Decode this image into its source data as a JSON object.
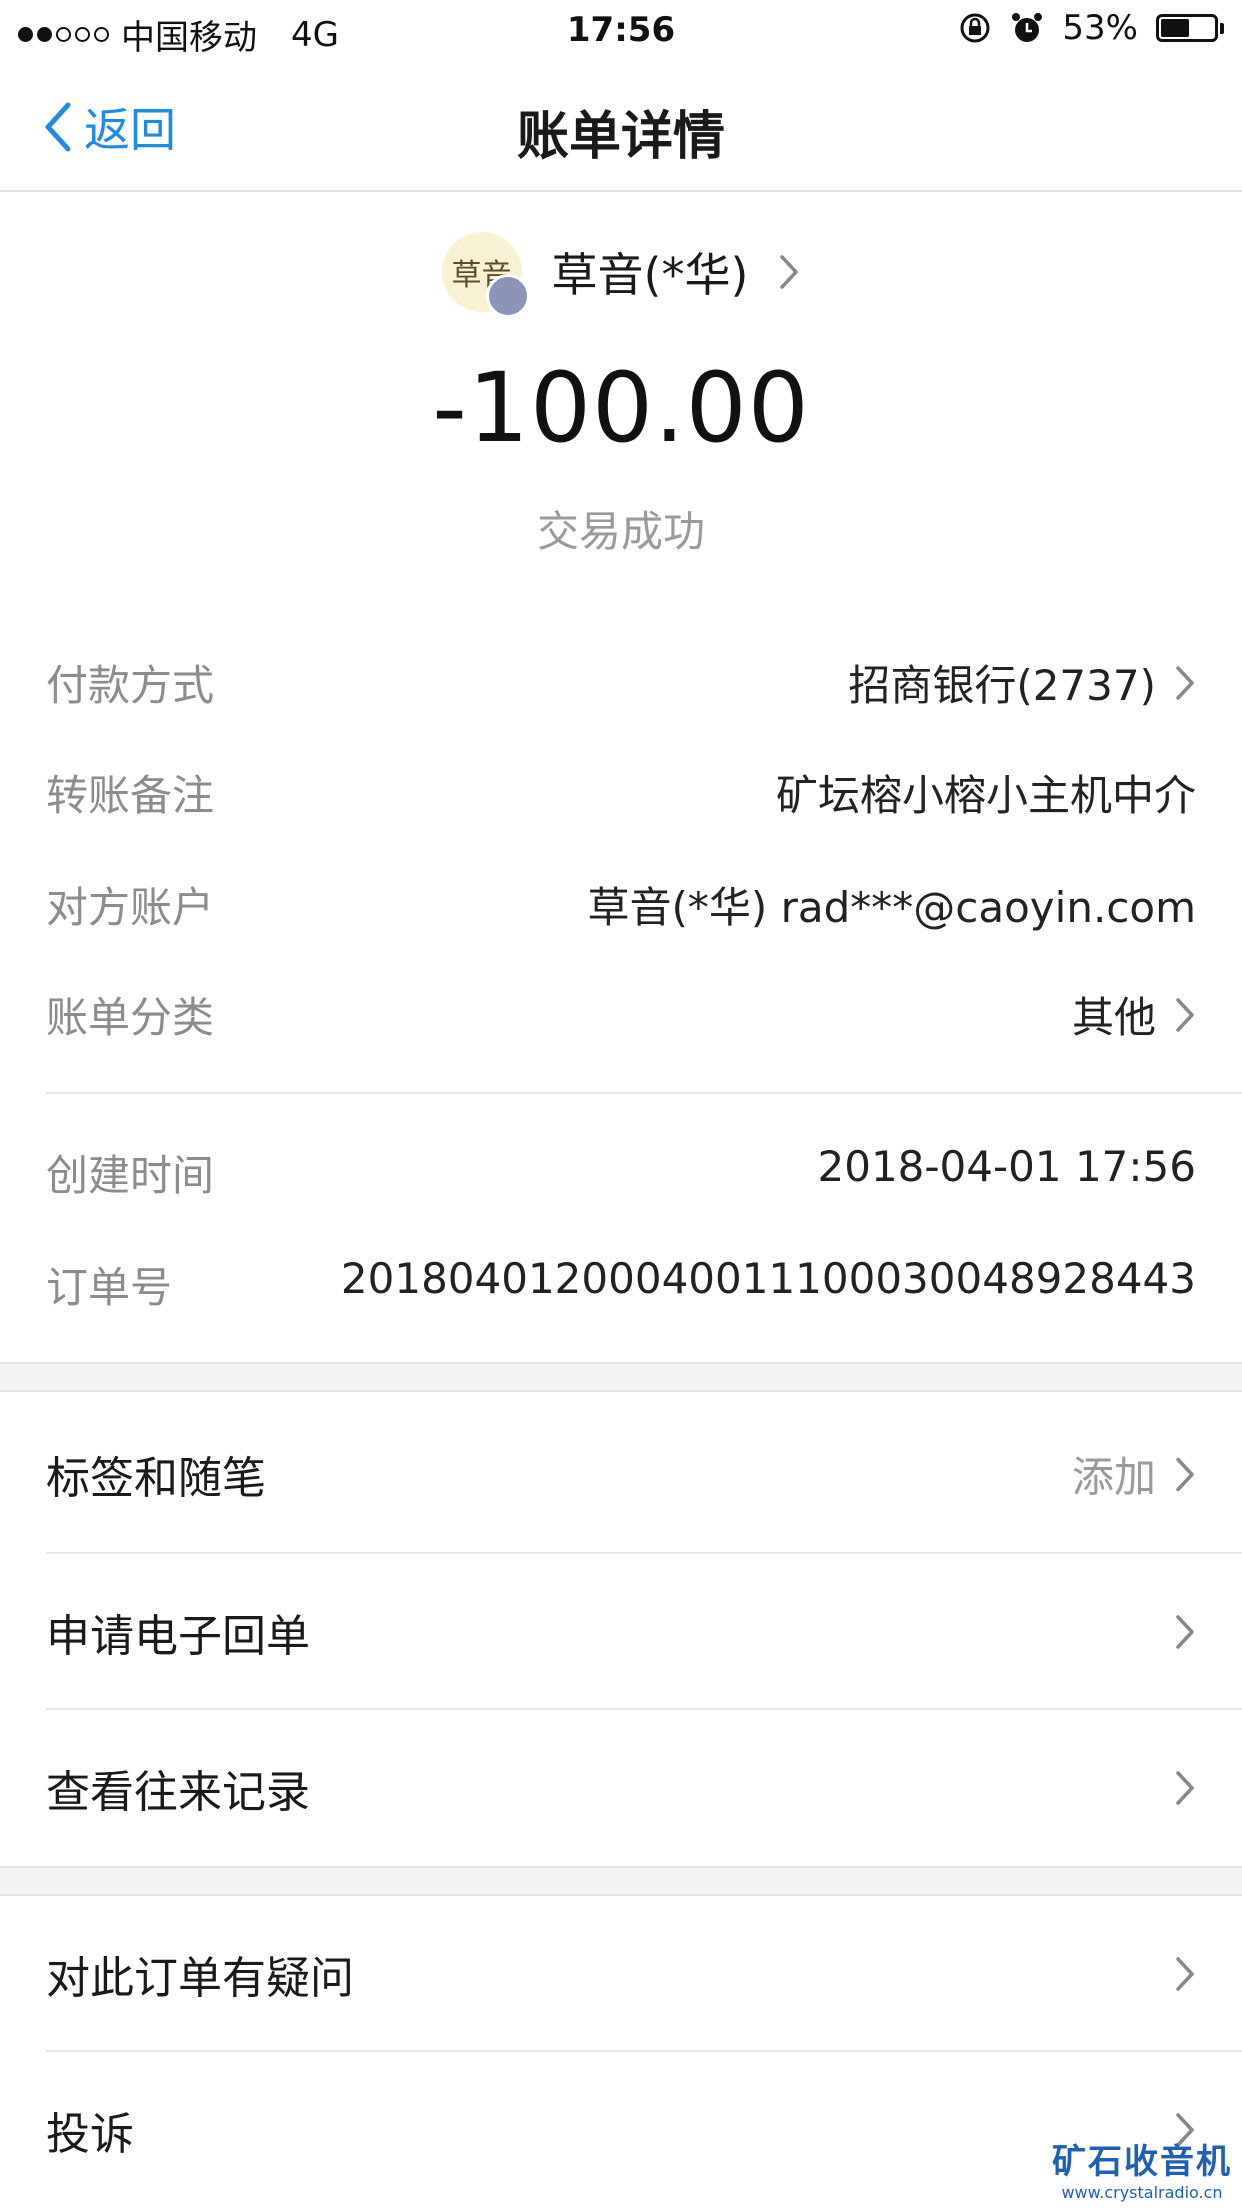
{
  "status_bar": {
    "carrier": "中国移动",
    "network": "4G",
    "time": "17:56",
    "battery_text": "53%",
    "battery_level": 0.53
  },
  "nav": {
    "back_label": "返回",
    "title": "账单详情"
  },
  "header": {
    "avatar_text": "草音",
    "payee": "草音(*华)",
    "amount": "-100.00",
    "status": "交易成功"
  },
  "details": [
    {
      "label": "付款方式",
      "value": "招商银行(2737)",
      "chevron": true
    },
    {
      "label": "转账备注",
      "value": "矿坛榕小榕小主机中介",
      "chevron": false
    },
    {
      "label": "对方账户",
      "value": "草音(*华) rad***@caoyin.com",
      "chevron": false
    },
    {
      "label": "账单分类",
      "value": "其他",
      "chevron": true
    },
    {
      "label": "创建时间",
      "value": "2018-04-01 17:56",
      "chevron": false
    },
    {
      "label": "订单号",
      "value": "20180401200040011100030048928443",
      "chevron": false
    }
  ],
  "actions": [
    {
      "label": "标签和随笔",
      "hint": "添加"
    },
    {
      "label": "申请电子回单",
      "hint": ""
    },
    {
      "label": "查看往来记录",
      "hint": ""
    },
    {
      "label": "对此订单有疑问",
      "hint": ""
    },
    {
      "label": "投诉",
      "hint": ""
    }
  ],
  "watermark": {
    "title": "矿石收音机",
    "url": "www.crystalradio.cn"
  },
  "colors": {
    "accent": "#1e8ce6",
    "label_gray": "#8c8c8c",
    "band_gray": "#f2f2f4"
  }
}
